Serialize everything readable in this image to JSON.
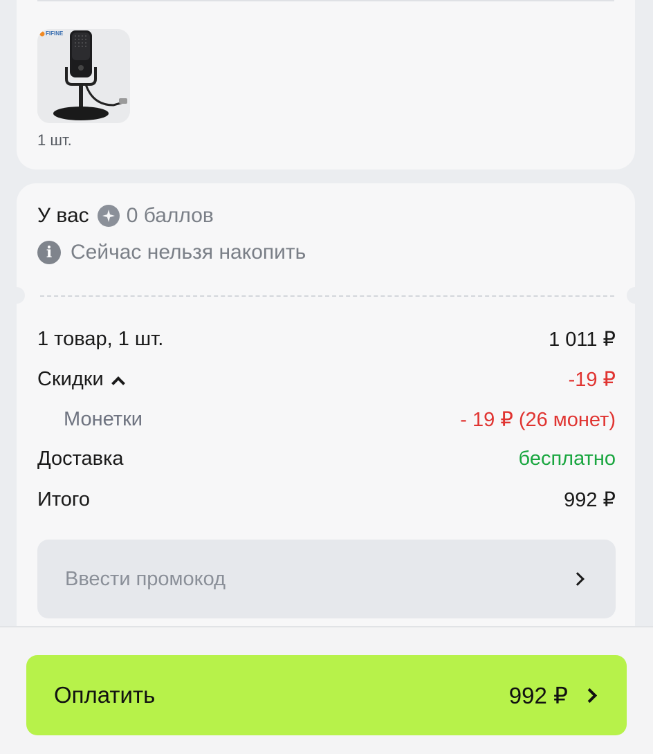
{
  "product": {
    "brand_logo": "FIFINE",
    "image": "usb-microphone",
    "quantity": "1 шт."
  },
  "points": {
    "prefix": "У вас",
    "icon": "sparkle-coin-icon",
    "value": "0 баллов",
    "info_icon": "info-icon",
    "info_text": "Сейчас нельзя накопить"
  },
  "summary": {
    "items_label": "1 товар, 1 шт.",
    "items_value": "1 011 ₽",
    "discounts_label": "Скидки",
    "discounts_value": "-19 ₽",
    "coins_label": "Монетки",
    "coins_value": "- 19 ₽ (26 монет)",
    "delivery_label": "Доставка",
    "delivery_value": "бесплатно",
    "total_label": "Итого",
    "total_value": "992 ₽"
  },
  "promo": {
    "label": "Ввести промокод"
  },
  "pay": {
    "label": "Оплатить",
    "amount": "992 ₽"
  },
  "colors": {
    "accent_green_button": "#b7f24a",
    "discount_red": "#e03431",
    "free_green": "#1aa640"
  }
}
